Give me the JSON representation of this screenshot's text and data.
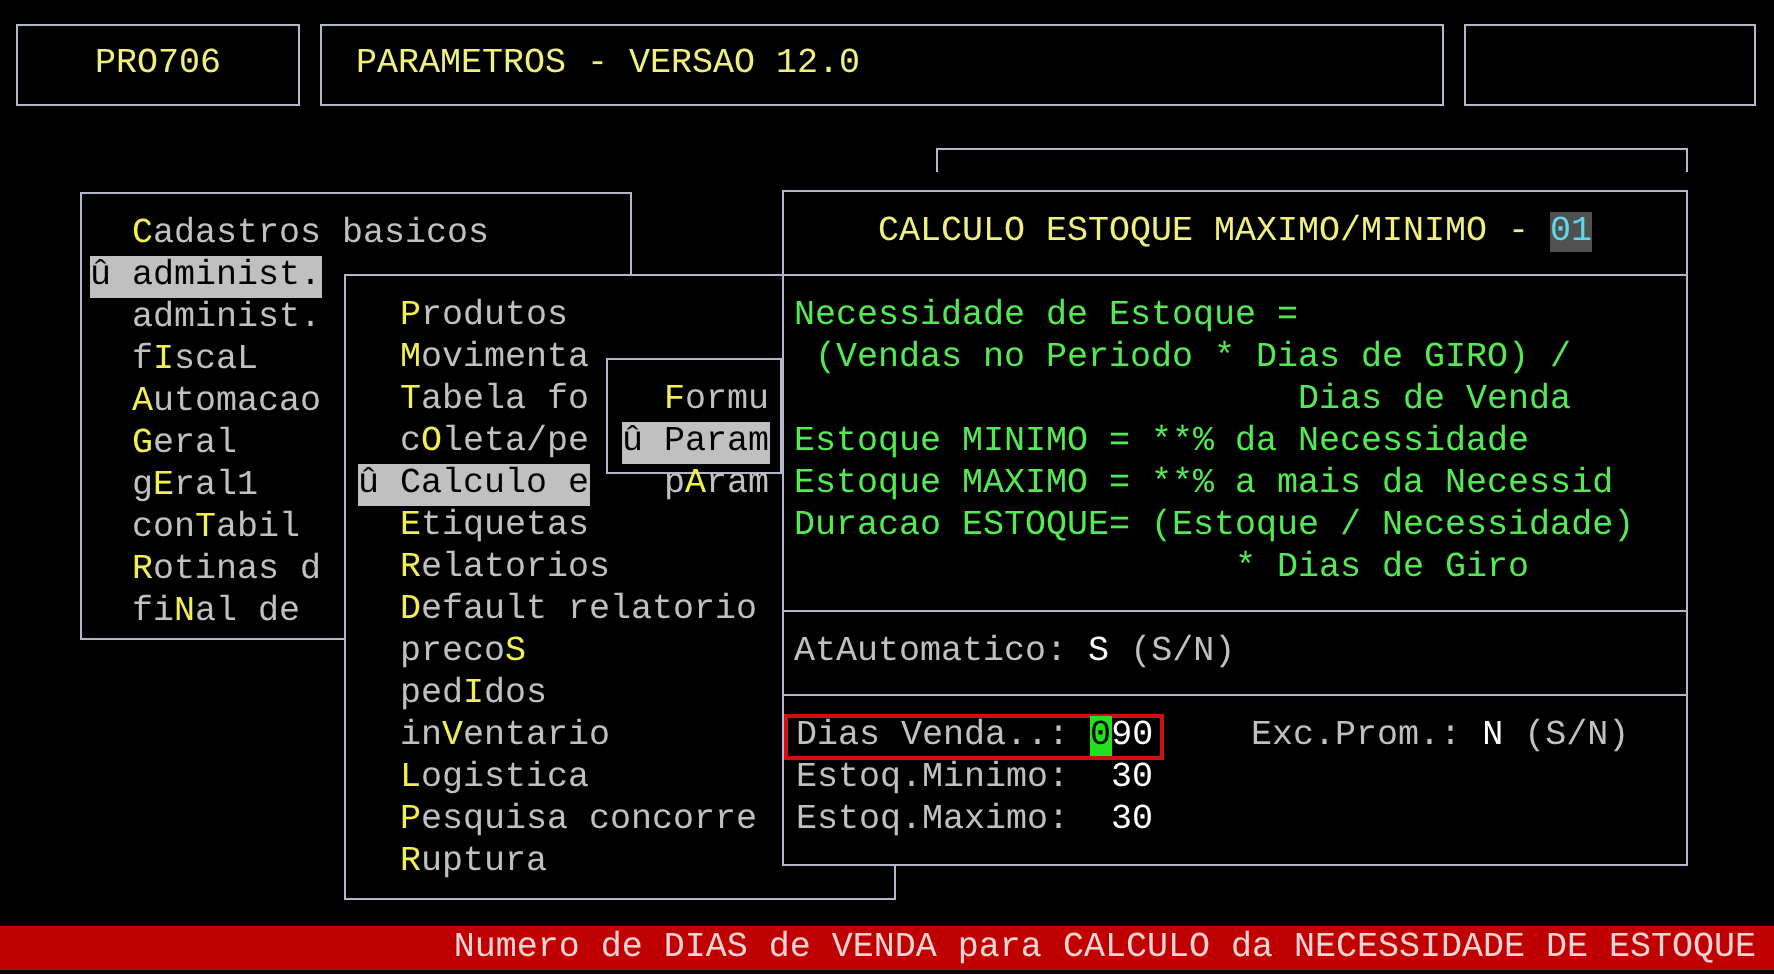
{
  "header": {
    "program_code": "PRO706",
    "title": "PARAMETROS - VERSAO 12.0"
  },
  "menus": [
    {
      "items": [
        {
          "key": "C",
          "post": "adastros basicos",
          "selected": false
        },
        {
          "pre": "û administ.",
          "selected": true
        },
        {
          "pre": "administ.",
          "selected": false
        },
        {
          "pre": "f",
          "key": "I",
          "post": "scaL",
          "selected": false
        },
        {
          "key": "A",
          "post": "utomacao",
          "selected": false
        },
        {
          "key": "G",
          "post": "eral",
          "selected": false
        },
        {
          "pre": "g",
          "key": "E",
          "post": "ral1",
          "selected": false
        },
        {
          "pre": "con",
          "key": "T",
          "post": "abil",
          "selected": false
        },
        {
          "key": "R",
          "post": "otinas d",
          "selected": false
        },
        {
          "pre": "fi",
          "key": "N",
          "post": "al de",
          "selected": false
        }
      ]
    },
    {
      "items": [
        {
          "key": "P",
          "post": "rodutos",
          "selected": false
        },
        {
          "key": "M",
          "post": "ovimenta",
          "selected": false
        },
        {
          "key": "T",
          "post": "abela fo",
          "selected": false
        },
        {
          "pre": "c",
          "key": "O",
          "post": "leta/pe",
          "selected": false
        },
        {
          "pre": "û Calculo e",
          "selected": true
        },
        {
          "key": "E",
          "post": "tiquetas",
          "selected": false
        },
        {
          "key": "R",
          "post": "elatorios",
          "selected": false
        },
        {
          "key": "D",
          "post": "efault relatorio",
          "selected": false
        },
        {
          "pre": "preco",
          "key": "S",
          "selected": false
        },
        {
          "pre": "ped",
          "key": "I",
          "post": "dos",
          "selected": false
        },
        {
          "pre": "in",
          "key": "V",
          "post": "entario",
          "selected": false
        },
        {
          "key": "L",
          "post": "ogistica",
          "selected": false
        },
        {
          "key": "P",
          "post": "esquisa concorre",
          "selected": false
        },
        {
          "key": "R",
          "post": "uptura",
          "selected": false
        }
      ]
    },
    {
      "items": [
        {
          "key": "F",
          "post": "ormu",
          "selected": false
        },
        {
          "pre": "û Param",
          "selected": true
        },
        {
          "pre": "p",
          "key": "A",
          "post": "ram",
          "selected": false
        }
      ]
    }
  ],
  "panel": {
    "title": "CALCULO ESTOQUE MAXIMO/MINIMO - ",
    "title_code": "01",
    "formula": [
      "Necessidade de Estoque =",
      " (Vendas no Periodo * Dias de GIRO) /",
      "                        Dias de Venda",
      "Estoque MINIMO = **% da Necessidade",
      "Estoque MAXIMO = **% a mais da Necessid",
      "Duracao ESTOQUE= (Estoque / Necessidade)",
      "                     * Dias de Giro"
    ],
    "auto": {
      "label": "AtAutomatico:",
      "value": "S",
      "hint": "(S/N)"
    },
    "fields": [
      {
        "label": "Dias Venda..:",
        "value": "090",
        "focused": true
      },
      {
        "label": "Estoq.Minimo:",
        "value": "30",
        "focused": false
      },
      {
        "label": "Estoq.Maximo:",
        "value": "30",
        "focused": false
      }
    ],
    "exc": {
      "label": "Exc.Prom.:",
      "value": "N",
      "hint": "(S/N)"
    }
  },
  "status_bar": "Numero de DIAS de VENDA para CALCULO da NECESSIDADE DE ESTOQUE"
}
